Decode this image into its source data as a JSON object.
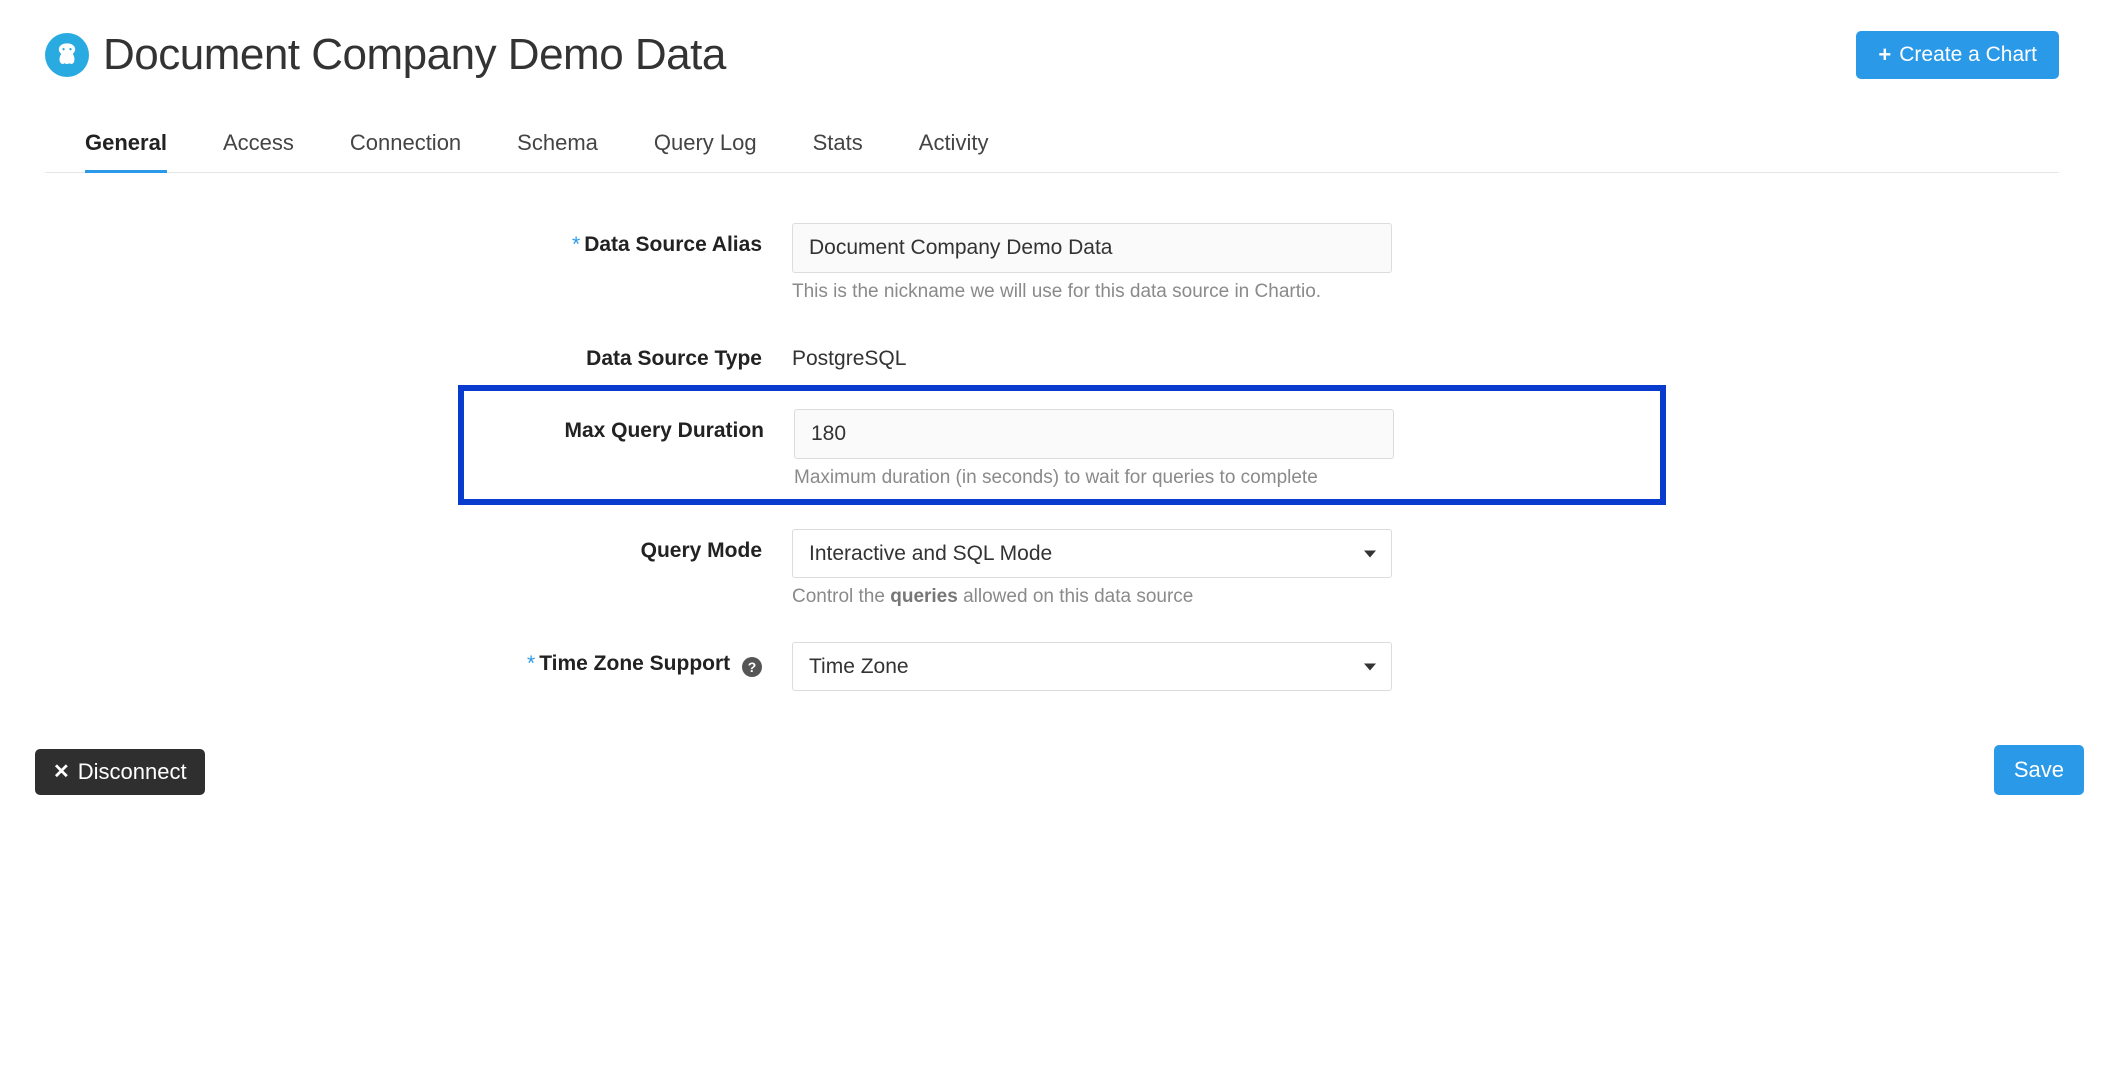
{
  "header": {
    "title": "Document Company Demo Data",
    "create_chart_label": "Create a Chart"
  },
  "tabs": [
    {
      "label": "General",
      "active": true
    },
    {
      "label": "Access",
      "active": false
    },
    {
      "label": "Connection",
      "active": false
    },
    {
      "label": "Schema",
      "active": false
    },
    {
      "label": "Query Log",
      "active": false
    },
    {
      "label": "Stats",
      "active": false
    },
    {
      "label": "Activity",
      "active": false
    }
  ],
  "form": {
    "alias": {
      "label": "Data Source Alias",
      "value": "Document Company Demo Data",
      "help": "This is the nickname we will use for this data source in Chartio."
    },
    "type": {
      "label": "Data Source Type",
      "value": "PostgreSQL"
    },
    "max_query_duration": {
      "label": "Max Query Duration",
      "value": "180",
      "help": "Maximum duration (in seconds) to wait for queries to complete"
    },
    "query_mode": {
      "label": "Query Mode",
      "value": "Interactive and SQL Mode",
      "help_prefix": "Control the ",
      "help_bold": "queries",
      "help_suffix": " allowed on this data source"
    },
    "timezone": {
      "label": "Time Zone Support",
      "value": "Time Zone"
    }
  },
  "footer": {
    "disconnect_label": "Disconnect",
    "save_label": "Save"
  }
}
